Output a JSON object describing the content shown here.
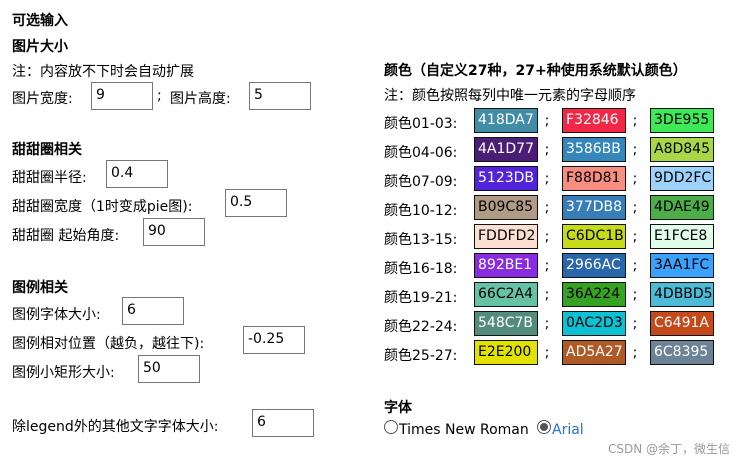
{
  "left": {
    "optional_heading": "可选输入",
    "image_size": {
      "heading": "图片大小",
      "note": "注：内容放不下时会自动扩展",
      "width_label": "图片宽度:",
      "width_value": "9",
      "height_sep": ";",
      "height_label": "图片高度:",
      "height_value": "5"
    },
    "donut": {
      "heading": "甜甜圈相关",
      "radius_label": "甜甜圈半径:",
      "radius_value": "0.4",
      "width_label": "甜甜圈宽度（1时变成pie图):",
      "width_value": "0.5",
      "start_label": "甜甜圈 起始角度:",
      "start_value": "90"
    },
    "legend": {
      "heading": "图例相关",
      "font_label": "图例字体大小:",
      "font_value": "6",
      "pos_label": "图例相对位置（越负，越往下):",
      "pos_value": "-0.25",
      "rect_label": "图例小矩形大小:",
      "rect_value": "50"
    },
    "other_font": {
      "label": "除legend外的其他文字字体大小:",
      "value": "6"
    }
  },
  "colors": {
    "heading": "颜色（自定义27种，27+种使用系统默认颜色）",
    "note": "注：颜色按照每列中唯一元素的字母顺序",
    "separator": ";",
    "rows": [
      {
        "label": "颜色01-03:",
        "swatches": [
          {
            "code": "418DA7",
            "bg": "#418DA7",
            "fg": "#ffffff"
          },
          {
            "code": "F32846",
            "bg": "#F32846",
            "fg": "#ffffff"
          },
          {
            "code": "3DE955",
            "bg": "#3DE955",
            "fg": "#000000"
          }
        ]
      },
      {
        "label": "颜色04-06:",
        "swatches": [
          {
            "code": "4A1D77",
            "bg": "#4A1D77",
            "fg": "#ffffff"
          },
          {
            "code": "3586BB",
            "bg": "#3586BB",
            "fg": "#ffffff"
          },
          {
            "code": "A8D845",
            "bg": "#A8D845",
            "fg": "#000000"
          }
        ]
      },
      {
        "label": "颜色07-09:",
        "swatches": [
          {
            "code": "5123DB",
            "bg": "#5123DB",
            "fg": "#ffffff"
          },
          {
            "code": "F88D81",
            "bg": "#F88D81",
            "fg": "#000000"
          },
          {
            "code": "9DD2FC",
            "bg": "#9DD2FC",
            "fg": "#000000"
          }
        ]
      },
      {
        "label": "颜色10-12:",
        "swatches": [
          {
            "code": "B09C85",
            "bg": "#B09C85",
            "fg": "#000000"
          },
          {
            "code": "377DB8",
            "bg": "#377DB8",
            "fg": "#ffffff"
          },
          {
            "code": "4DAE49",
            "bg": "#4DAE49",
            "fg": "#000000"
          }
        ]
      },
      {
        "label": "颜色13-15:",
        "swatches": [
          {
            "code": "FDDFD2",
            "bg": "#FDDFD2",
            "fg": "#000000"
          },
          {
            "code": "C6DC1B",
            "bg": "#C6DC1B",
            "fg": "#000000"
          },
          {
            "code": "E1FCE8",
            "bg": "#E1FCE8",
            "fg": "#000000"
          }
        ]
      },
      {
        "label": "颜色16-18:",
        "swatches": [
          {
            "code": "892BE1",
            "bg": "#892BE1",
            "fg": "#ffffff"
          },
          {
            "code": "2966AC",
            "bg": "#2966AC",
            "fg": "#ffffff"
          },
          {
            "code": "3AA1FC",
            "bg": "#3AA1FC",
            "fg": "#000000"
          }
        ]
      },
      {
        "label": "颜色19-21:",
        "swatches": [
          {
            "code": "66C2A4",
            "bg": "#66C2A4",
            "fg": "#000000"
          },
          {
            "code": "36A224",
            "bg": "#36A224",
            "fg": "#000000"
          },
          {
            "code": "4DBBD5",
            "bg": "#4DBBD5",
            "fg": "#000000"
          }
        ]
      },
      {
        "label": "颜色22-24:",
        "swatches": [
          {
            "code": "548C7B",
            "bg": "#548C7B",
            "fg": "#ffffff"
          },
          {
            "code": "0AC2D3",
            "bg": "#0AC2D3",
            "fg": "#000000"
          },
          {
            "code": "C6491A",
            "bg": "#C6491A",
            "fg": "#ffffff"
          }
        ]
      },
      {
        "label": "颜色25-27:",
        "swatches": [
          {
            "code": "E2E200",
            "bg": "#E2E200",
            "fg": "#000000"
          },
          {
            "code": "AD5A27",
            "bg": "#AD5A27",
            "fg": "#ffffff"
          },
          {
            "code": "6C8395",
            "bg": "#6C8395",
            "fg": "#ffffff"
          }
        ]
      }
    ]
  },
  "font": {
    "heading": "字体",
    "option1": "Times New Roman",
    "option2": "Arial",
    "selected": "Arial",
    "selected_color": "#1a73e8"
  },
  "watermark": "CSDN @余丁，微生信"
}
